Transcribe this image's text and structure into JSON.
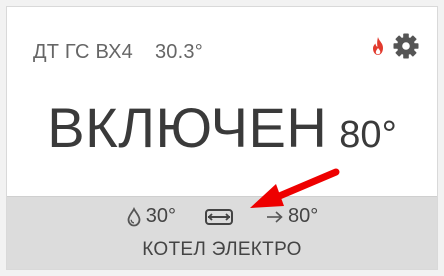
{
  "header": {
    "device_name": "ДТ ГС ВХ4",
    "current_temp": "30.3°"
  },
  "status": {
    "state": "ВКЛЮЧЕН",
    "target_temp": "80°"
  },
  "footer": {
    "water_temp": "30°",
    "flow_target": "80°",
    "device_label": "КОТЕЛ ЭЛЕКТРО"
  },
  "icons": {
    "flame": "flame-icon",
    "settings": "gear-icon",
    "water": "water-drop-icon",
    "heater": "heater-icon",
    "arrow": "arrow-right-icon"
  },
  "colors": {
    "flame": "#e23b2e",
    "annotation": "#ee0000",
    "footer_bg": "#dcdcdc"
  }
}
